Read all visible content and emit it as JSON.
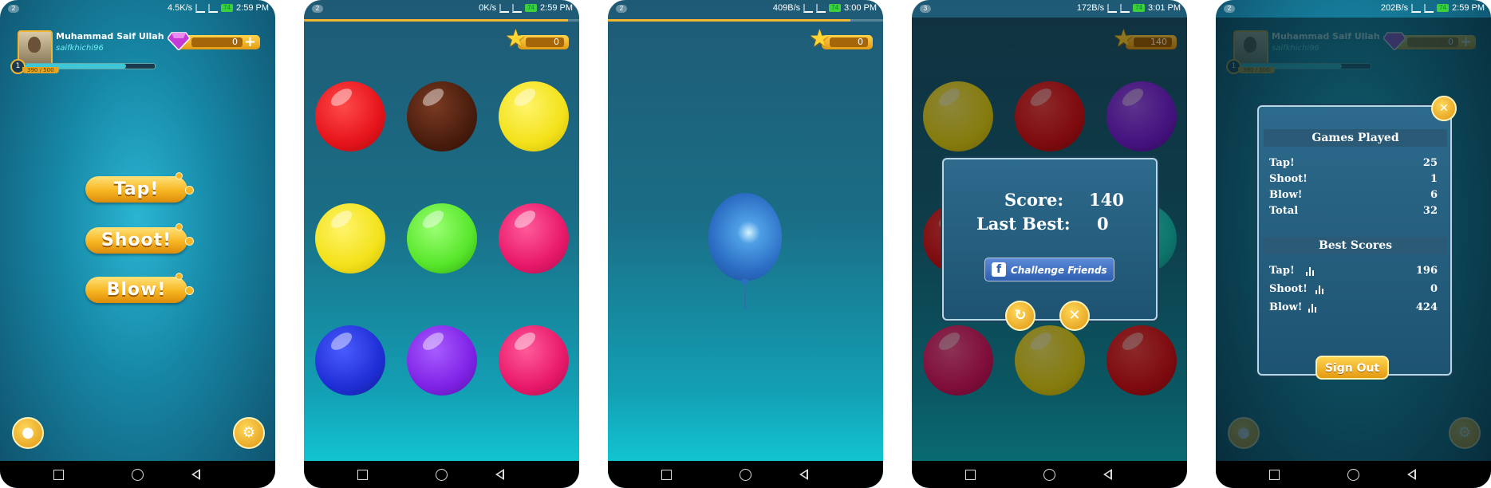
{
  "phones": [
    {
      "status": {
        "badge": "2",
        "speed": "4.5K/s",
        "battery": "74",
        "time": "2:59 PM"
      },
      "profile": {
        "name": "Muhammad Saif Ullah",
        "handle": "saifkhichi96",
        "level": "1",
        "xp_text": "390 / 500",
        "xp_fraction": 0.78
      },
      "gems": "0",
      "menu": {
        "tap": "Tap!",
        "shoot": "Shoot!",
        "blow": "Blow!"
      }
    },
    {
      "status": {
        "badge": "2",
        "speed": "0K/s",
        "battery": "74",
        "time": "2:59 PM"
      },
      "score": "0",
      "progress_fraction": 0.96,
      "bubbles": [
        "#e6141b",
        "#4a1d0d",
        "#f3e21a",
        "#f3e21a",
        "#57e62b",
        "#e8196a",
        "#1f2fd6",
        "#7f22e6",
        "#e8196a"
      ]
    },
    {
      "status": {
        "badge": "2",
        "speed": "409B/s",
        "battery": "74",
        "time": "3:00 PM"
      },
      "score": "0",
      "progress_fraction": 0.88
    },
    {
      "status": {
        "badge": "3",
        "speed": "172B/s",
        "battery": "74",
        "time": "3:01 PM"
      },
      "score": "140",
      "dialog": {
        "score_label": "Score:",
        "score_value": "140",
        "best_label": "Last Best:",
        "best_value": "0",
        "fb_button": "Challenge Friends"
      }
    },
    {
      "status": {
        "badge": "2",
        "speed": "202B/s",
        "battery": "74",
        "time": "2:59 PM"
      },
      "profile": {
        "name": "Muhammad Saif Ullah",
        "handle": "saifkhichi96",
        "level": "1",
        "xp_text": "390 / 500"
      },
      "gems": "0",
      "stats": {
        "games_played_title": "Games Played",
        "games_played": [
          {
            "label": "Tap!",
            "value": "25"
          },
          {
            "label": "Shoot!",
            "value": "1"
          },
          {
            "label": "Blow!",
            "value": "6"
          },
          {
            "label": "Total",
            "value": "32"
          }
        ],
        "best_scores_title": "Best Scores",
        "best_scores": [
          {
            "label": "Tap!",
            "value": "196"
          },
          {
            "label": "Shoot!",
            "value": "0"
          },
          {
            "label": "Blow!",
            "value": "424"
          }
        ],
        "sign_out": "Sign Out"
      }
    }
  ],
  "colors": {
    "accent": "#f2b632",
    "handle": "#6ef0f5"
  }
}
